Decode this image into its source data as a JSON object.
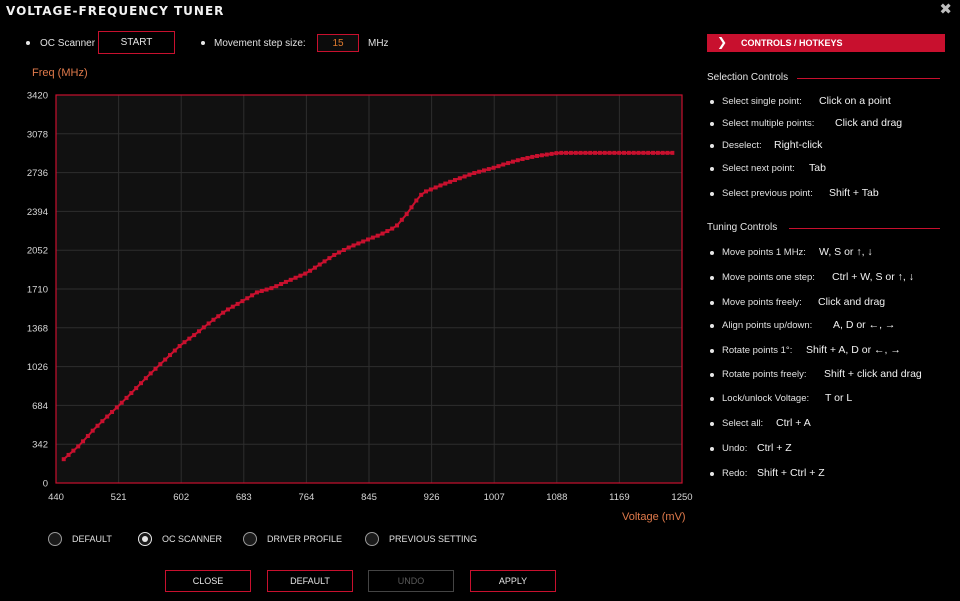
{
  "window": {
    "title": "VOLTAGE-FREQUENCY TUNER",
    "close_glyph": "✖"
  },
  "toolbar": {
    "oc_scanner_label": "OC Scanner",
    "start_label": "START",
    "step_label": "Movement step size:",
    "step_value": "15",
    "step_unit": "MHz"
  },
  "chart_data": {
    "type": "scatter",
    "ylabel": "Freq (MHz)",
    "xlabel": "Voltage (mV)",
    "xlim": [
      440,
      1250
    ],
    "ylim": [
      0,
      3420
    ],
    "x_ticks": [
      "440",
      "521",
      "602",
      "683",
      "764",
      "845",
      "926",
      "1007",
      "1088",
      "1169",
      "1250"
    ],
    "y_ticks": [
      "0",
      "342",
      "684",
      "1026",
      "1368",
      "1710",
      "2052",
      "2394",
      "2736",
      "3078",
      "3420"
    ],
    "grid": true,
    "point_color": "#c8102e",
    "curve_knots": {
      "x": [
        450,
        470,
        490,
        510,
        521,
        540,
        560,
        580,
        602,
        620,
        640,
        660,
        683,
        700,
        720,
        740,
        764,
        780,
        800,
        820,
        845,
        860,
        880,
        895,
        905,
        915,
        926,
        940,
        960,
        980,
        1007,
        1020,
        1040,
        1060,
        1080,
        1090,
        1100,
        1130,
        1160,
        1200,
        1240
      ],
      "y": [
        210,
        330,
        480,
        610,
        680,
        810,
        950,
        1080,
        1220,
        1310,
        1420,
        1520,
        1610,
        1680,
        1720,
        1780,
        1850,
        1920,
        2010,
        2080,
        2150,
        2190,
        2260,
        2380,
        2480,
        2560,
        2590,
        2630,
        2680,
        2730,
        2780,
        2810,
        2850,
        2880,
        2900,
        2910,
        2910,
        2910,
        2910,
        2910,
        2910
      ]
    }
  },
  "radios": [
    {
      "label": "DEFAULT",
      "selected": false
    },
    {
      "label": "OC SCANNER",
      "selected": true
    },
    {
      "label": "DRIVER PROFILE",
      "selected": false
    },
    {
      "label": "PREVIOUS SETTING",
      "selected": false
    }
  ],
  "buttons": {
    "close": "CLOSE",
    "default": "DEFAULT",
    "undo": "UNDO",
    "apply": "APPLY"
  },
  "panel": {
    "heading": "CONTROLS / HOTKEYS",
    "selection_title": "Selection Controls",
    "selection": [
      {
        "label": "Select single point:",
        "key": "Click on a point"
      },
      {
        "label": "Select multiple points:",
        "key": "Click and drag"
      },
      {
        "label": "Deselect:",
        "key": "Right-click"
      },
      {
        "label": "Select next point:",
        "key": "Tab"
      },
      {
        "label": "Select previous point:",
        "key": "Shift + Tab"
      }
    ],
    "tuning_title": "Tuning Controls",
    "tuning": [
      {
        "label": "Move points 1 MHz:",
        "key": "W, S or ↑, ↓"
      },
      {
        "label": "Move points one step:",
        "key": "Ctrl + W, S or ↑, ↓"
      },
      {
        "label": "Move points freely:",
        "key": "Click and drag"
      },
      {
        "label": "Align points up/down:",
        "key": "A, D or ←, →"
      },
      {
        "label": "Rotate points 1°:",
        "key": "Shift + A, D or ←, →"
      },
      {
        "label": "Rotate points freely:",
        "key": "Shift + click and drag"
      },
      {
        "label": "Lock/unlock Voltage:",
        "key": "T or L"
      },
      {
        "label": "Select all:",
        "key": "Ctrl + A"
      },
      {
        "label": "Undo:",
        "key": "Ctrl + Z"
      },
      {
        "label": "Redo:",
        "key": "Shift + Ctrl + Z"
      }
    ]
  }
}
